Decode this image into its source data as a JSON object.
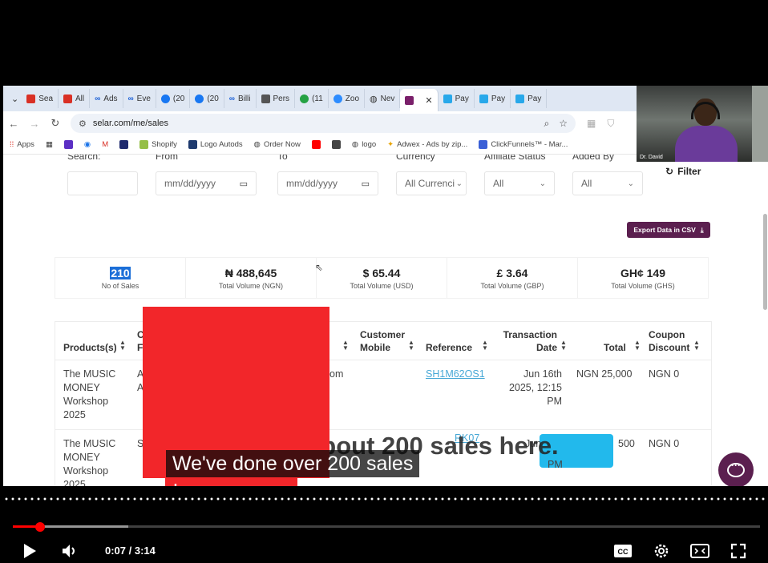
{
  "browser": {
    "tabs": [
      "Sea",
      "All",
      "Ads",
      "Eve",
      "(20",
      "(20",
      "Billi",
      "Pers",
      "(11",
      "Zoo",
      "Nev",
      "",
      "Pay",
      "Pay",
      "Pay"
    ],
    "url": "selar.com/me/sales",
    "bookmarks": [
      "Apps",
      "Shopify",
      "Logo Autods",
      "Order Now",
      "logo",
      "Adwex - Ads by zip...",
      "ClickFunnels™ - Mar..."
    ]
  },
  "webcam": {
    "name": "Dr. David"
  },
  "filters": {
    "labels": [
      "Search:",
      "From",
      "To",
      "Currency",
      "Affiliate Status",
      "Added By"
    ],
    "from_placeholder": "mm/dd/yyyy",
    "to_placeholder": "mm/dd/yyyy",
    "currency_value": "All Currenci",
    "affiliate_value": "All",
    "added_by_value": "All",
    "filter_label": "Filter"
  },
  "export_label": "Export Data in CSV",
  "stats": [
    {
      "value": "210",
      "label": "No of Sales"
    },
    {
      "value": "₦ 488,645",
      "label": "Total Volume (NGN)"
    },
    {
      "value": "$ 65.44",
      "label": "Total Volume (USD)"
    },
    {
      "value": "£ 3.64",
      "label": "Total Volume (GBP)"
    },
    {
      "value": "GH¢ 149",
      "label": "Total Volume (GHS)"
    }
  ],
  "table": {
    "headers": {
      "products": "Products(s)",
      "c": "C",
      "f": "F",
      "customer_mobile": "Customer Mobile",
      "reference": "Reference",
      "transaction_date": "Transaction Date",
      "total": "Total",
      "coupon_discount": "Coupon Discount"
    },
    "rows": [
      {
        "product": "The MUSIC MONEY Workshop 2025",
        "c": "A",
        "c2": "A",
        "email_tail": "om",
        "reference": "SH1M62OS1",
        "date": "Jun 16th 2025, 12:15 PM",
        "total": "NGN 25,000",
        "coupon": "NGN 0"
      },
      {
        "product": "The MUSIC MONEY Workshop 2025",
        "c": "S",
        "reference": "RK07",
        "date": "Jun",
        "date2": "PM",
        "total": "500",
        "coupon": "NGN 0"
      }
    ]
  },
  "burned_caption": "We've done about 200 sales here.",
  "burned_caption_line2": "here.",
  "caption": "We've done over 200 sales",
  "player": {
    "current_time": "0:07",
    "duration": "3:14",
    "progress_fraction": 0.036,
    "buffered_fraction": 0.155
  }
}
